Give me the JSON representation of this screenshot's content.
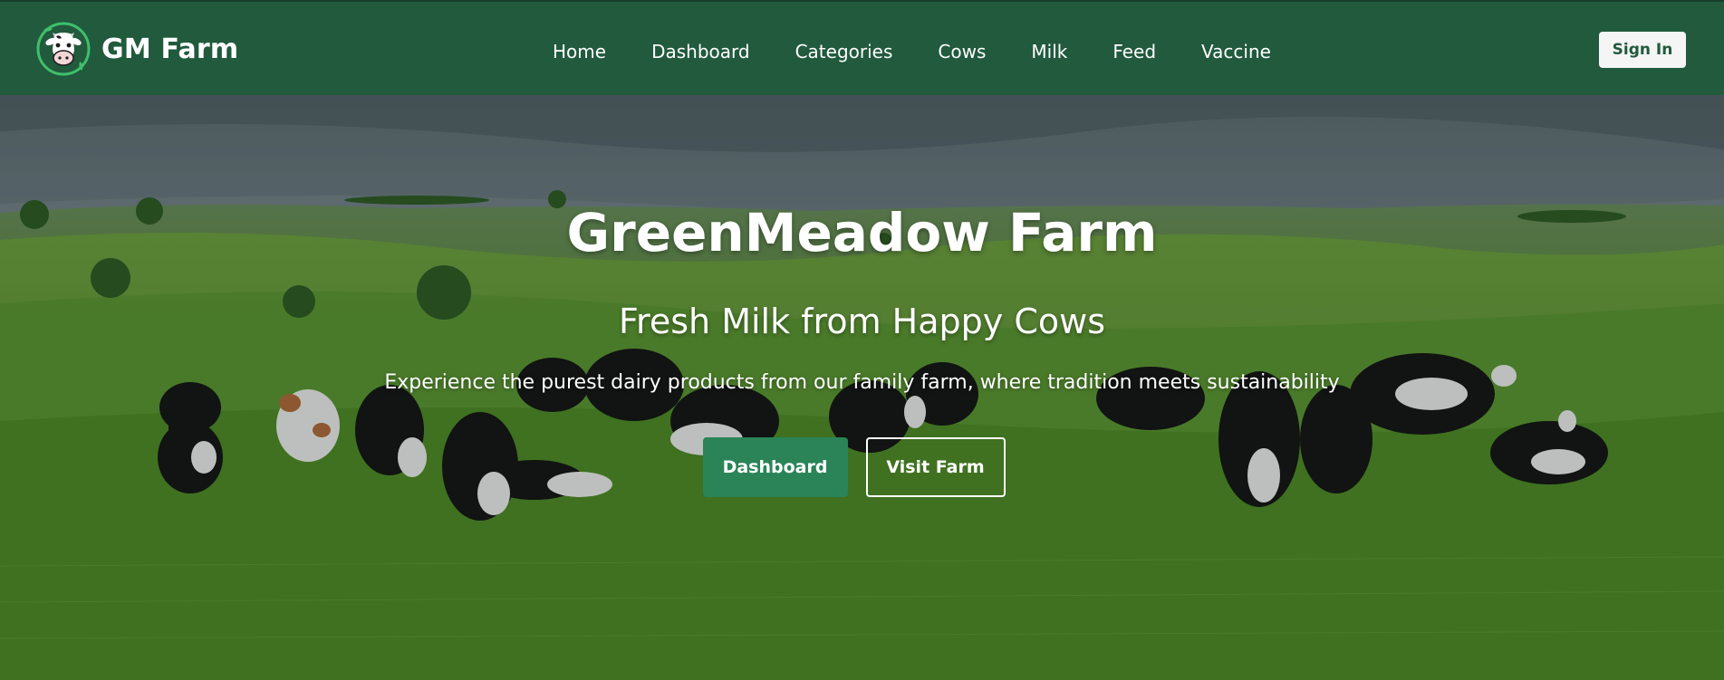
{
  "brand": {
    "name": "GM Farm",
    "logo_icon": "cow-logo-icon"
  },
  "nav": {
    "items": [
      {
        "label": "Home"
      },
      {
        "label": "Dashboard"
      },
      {
        "label": "Categories"
      },
      {
        "label": "Cows"
      },
      {
        "label": "Milk"
      },
      {
        "label": "Feed"
      },
      {
        "label": "Vaccine"
      }
    ],
    "signin_label": "Sign In"
  },
  "hero": {
    "title": "GreenMeadow Farm",
    "subtitle": "Fresh Milk from Happy Cows",
    "description": "Experience the purest dairy products from our family farm, where tradition meets sustainability",
    "primary_button": "Dashboard",
    "secondary_button": "Visit Farm"
  },
  "colors": {
    "navbar": "#215a3d",
    "primary_button": "#2a8457",
    "signin_text": "#215a3d"
  }
}
